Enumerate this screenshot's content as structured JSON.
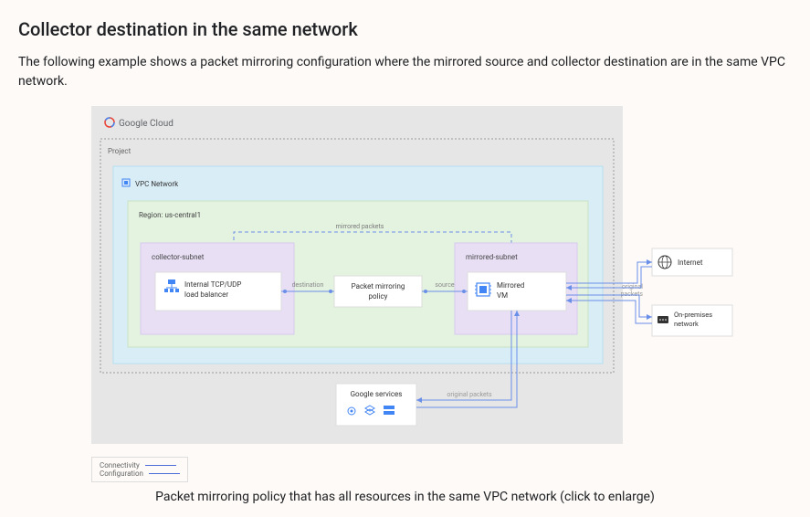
{
  "heading": "Collector destination in the same network",
  "intro": "The following example shows a packet mirroring configuration where the mirrored source and collector destination are in the same VPC network.",
  "caption": "Packet mirroring policy that has all resources in the same VPC network (click to enlarge)",
  "diagram": {
    "cloud_brand": "Google Cloud",
    "project_label": "Project",
    "vpc_label": "VPC Network",
    "region_label": "Region: us-central1",
    "collector_subnet": "collector-subnet",
    "mirrored_subnet": "mirrored-subnet",
    "collector_box": "Internal TCP/UDP load balancer",
    "policy_box": "Packet mirroring policy",
    "mirrored_vm": "Mirrored VM",
    "internet": "Internet",
    "onprem": "On-premises network",
    "google_services": "Google services",
    "label_mirrored_packets": "mirrored packets",
    "label_destination": "destination",
    "label_source": "source",
    "label_original_packets": "original packets",
    "legend_connectivity": "Connectivity",
    "legend_configuration": "Configuration"
  }
}
